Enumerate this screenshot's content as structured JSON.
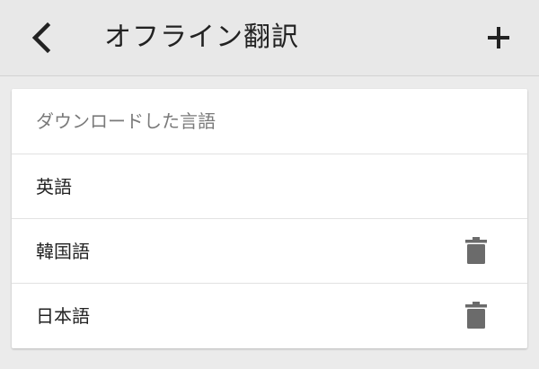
{
  "app_bar": {
    "title": "オフライン翻訳",
    "back_icon": "chevron-left-icon",
    "add_icon": "plus-icon"
  },
  "downloaded_section": {
    "header": "ダウンロードした言語",
    "languages": [
      {
        "label": "英語",
        "delete_icon": null
      },
      {
        "label": "韓国語",
        "delete_icon": "trash-icon"
      },
      {
        "label": "日本語",
        "delete_icon": "trash-icon"
      }
    ]
  },
  "colors": {
    "app_bar_background": "#e8e8e8",
    "page_background": "#ebebeb",
    "card_background": "#ffffff",
    "title_text": "#222222",
    "header_text": "#7a7a7a",
    "icon_gray": "#6b6b6b"
  }
}
